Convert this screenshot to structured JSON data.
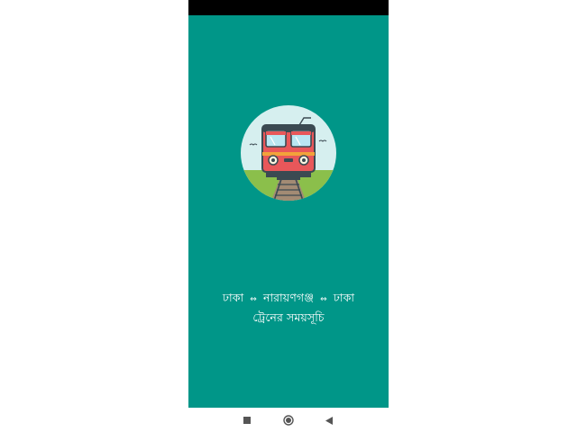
{
  "app": {
    "title_line1": {
      "from": "ঢাকা",
      "arrow1": "⇔",
      "via": "নারায়ণগঞ্জ",
      "arrow2": "⇔",
      "to": "ঢাকা"
    },
    "title_line2": "ট্রেনের সময়সূচি"
  },
  "logo": {
    "icon": "train-icon",
    "circle_color": "#d6efef",
    "train_color": "#e8575a",
    "ground_color": "#8bbf4b"
  },
  "navigation": {
    "buttons": [
      "recent-apps-icon",
      "home-icon",
      "back-icon"
    ]
  },
  "colors": {
    "background": "#009688",
    "status_bar": "#000000",
    "text": "#ffffff"
  }
}
